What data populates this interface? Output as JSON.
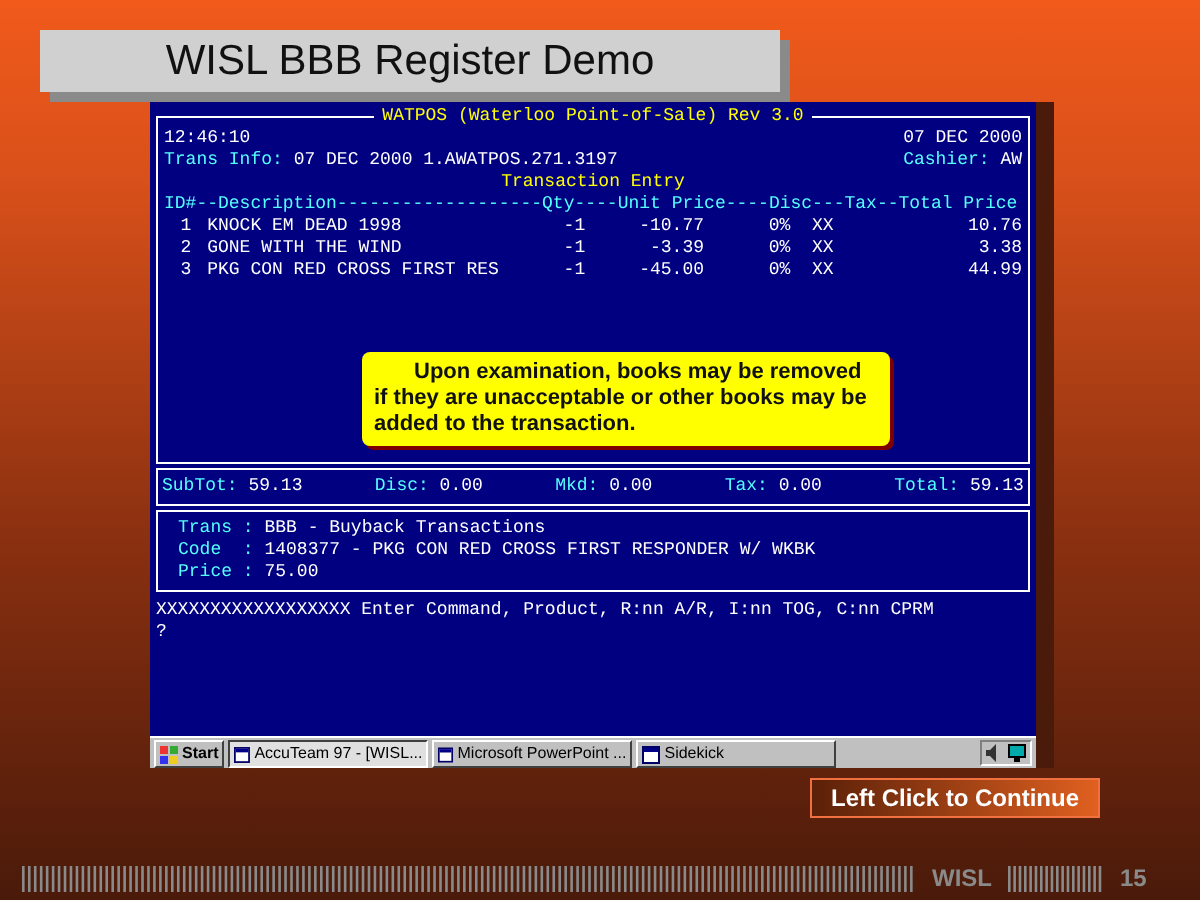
{
  "slide_title": "WISL BBB Register Demo",
  "pos": {
    "title": "WATPOS (Waterloo Point-of-Sale) Rev 3.0",
    "time": "12:46:10",
    "date": "07 DEC 2000",
    "trans_info_label": "Trans Info:",
    "trans_info": "07 DEC 2000 1.AWATPOS.271.3197",
    "cashier_label": "Cashier:",
    "cashier": "AW",
    "section": "Transaction Entry",
    "column_header": "ID#--Description-------------------Qty----Unit Price----Disc---Tax--Total Price",
    "rows": [
      {
        "id": "1",
        "description": "KNOCK EM DEAD 1998",
        "qty": "-1",
        "unit_price": "-10.77",
        "disc": "0%",
        "tax": "XX",
        "total": "10.76"
      },
      {
        "id": "2",
        "description": "GONE WITH THE WIND",
        "qty": "-1",
        "unit_price": "-3.39",
        "disc": "0%",
        "tax": "XX",
        "total": "3.38"
      },
      {
        "id": "3",
        "description": "PKG CON RED CROSS FIRST RES",
        "qty": "-1",
        "unit_price": "-45.00",
        "disc": "0%",
        "tax": "XX",
        "total": "44.99"
      }
    ],
    "totals": [
      {
        "label": "SubTot:",
        "value": "59.13"
      },
      {
        "label": "Disc:",
        "value": "0.00"
      },
      {
        "label": "Mkd:",
        "value": "0.00"
      },
      {
        "label": "Tax:",
        "value": "0.00"
      },
      {
        "label": "Total:",
        "value": "59.13"
      }
    ],
    "details": [
      {
        "label": "Trans :",
        "value": "BBB - Buyback Transactions"
      },
      {
        "label": "Code  :",
        "value": "1408377 - PKG CON RED CROSS FIRST RESPONDER W/ WKBK"
      },
      {
        "label": "Price :",
        "value": "75.00"
      }
    ],
    "command": "XXXXXXXXXXXXXXXXXX Enter Command, Product, R:nn A/R, I:nn TOG, C:nn CPRM",
    "prompt": "?"
  },
  "callout": "Upon examination, books may be removed if they are unacceptable or other books may be added to the transaction.",
  "taskbar": {
    "start": "Start",
    "tasks": [
      {
        "label": "AccuTeam 97 - [WISL...",
        "selected": true
      },
      {
        "label": "Microsoft PowerPoint ...",
        "selected": false
      },
      {
        "label": "Sidekick",
        "selected": false
      }
    ]
  },
  "continue_button": "Left Click to Continue",
  "footer": {
    "brand": "WISL",
    "page": "15"
  }
}
